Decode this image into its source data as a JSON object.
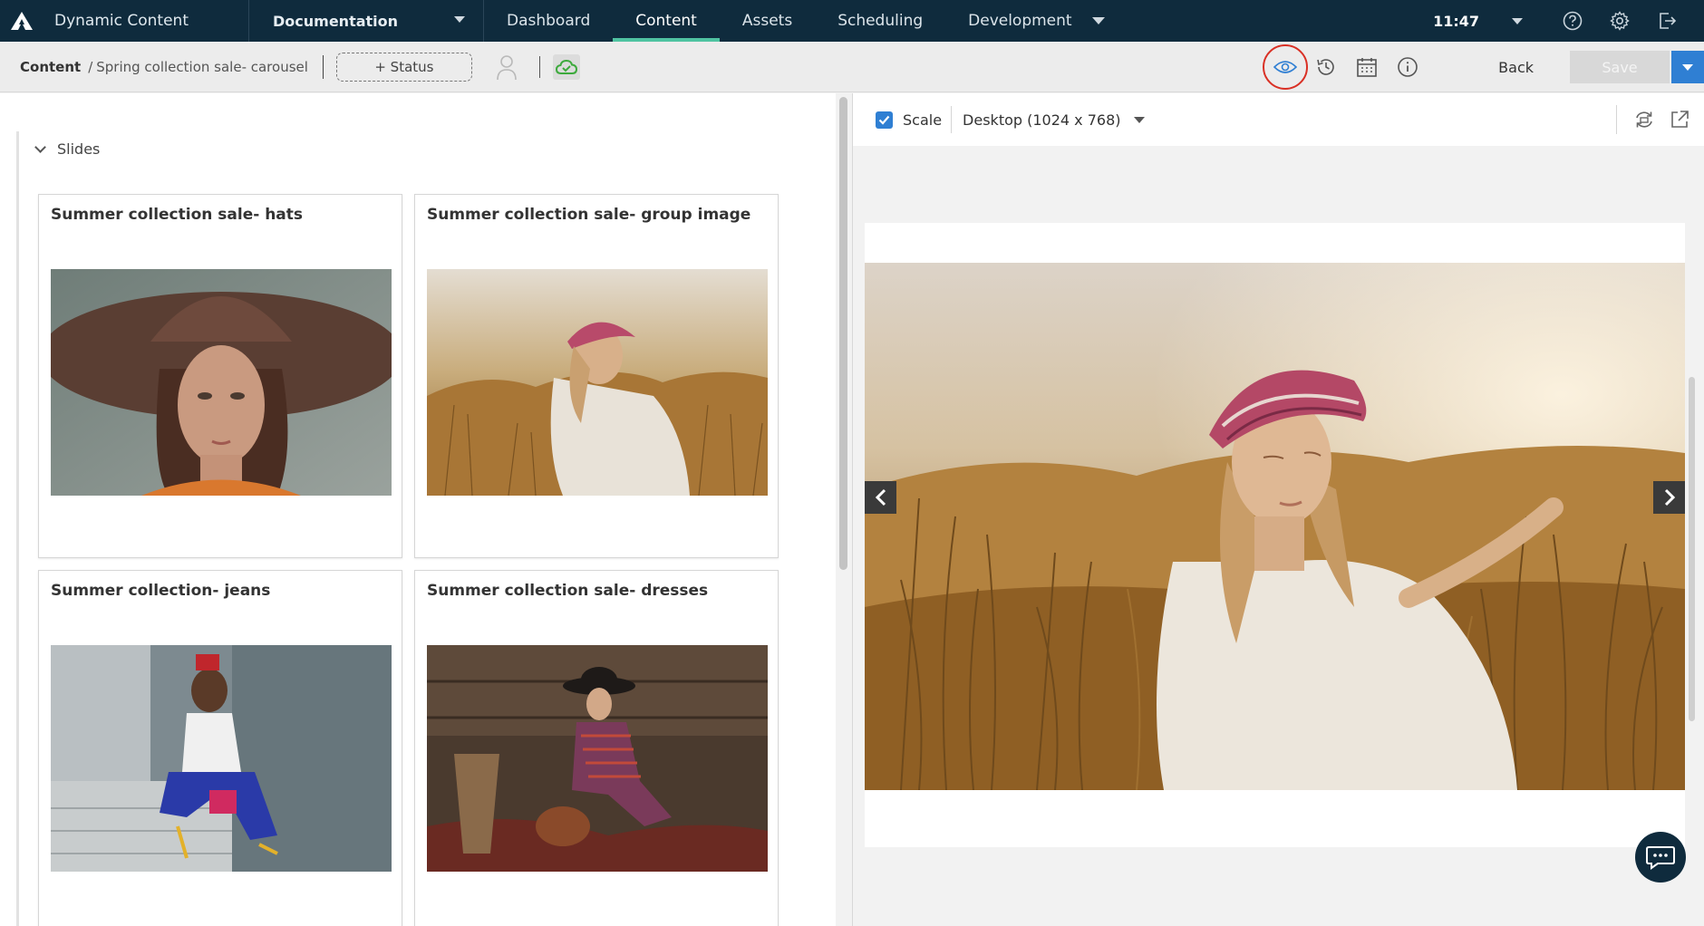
{
  "app": {
    "title": "Dynamic Content",
    "hub": "Documentation",
    "nav": [
      "Dashboard",
      "Content",
      "Assets",
      "Scheduling",
      "Development"
    ],
    "active_tab": "Content",
    "time": "11:47"
  },
  "toolbar": {
    "breadcrumb_root": "Content",
    "breadcrumb_sep": "/",
    "breadcrumb_current": "Spring collection sale- carousel",
    "status_label": "+ Status",
    "back_label": "Back",
    "save_label": "Save"
  },
  "editor": {
    "section_label": "Slides",
    "slides": [
      {
        "title": "Summer collection sale- hats"
      },
      {
        "title": "Summer collection sale- group image"
      },
      {
        "title": "Summer collection- jeans"
      },
      {
        "title": "Summer collection sale- dresses"
      }
    ]
  },
  "preview": {
    "scale_label": "Scale",
    "scale_checked": true,
    "device": "Desktop (1024 x 768)"
  },
  "colors": {
    "nav_bg": "#0f2b3d",
    "active_underline": "#4fc3a1",
    "accent_blue": "#2f7fd3",
    "highlight_ring": "#d93025",
    "cloud_green": "#3daa3d"
  },
  "icons": [
    "logo-icon",
    "help-icon",
    "gear-icon",
    "logout-icon",
    "user-icon",
    "cloud-sync-icon",
    "eye-icon",
    "history-icon",
    "calendar-icon",
    "info-icon",
    "refresh-icon",
    "external-link-icon",
    "chat-icon"
  ]
}
